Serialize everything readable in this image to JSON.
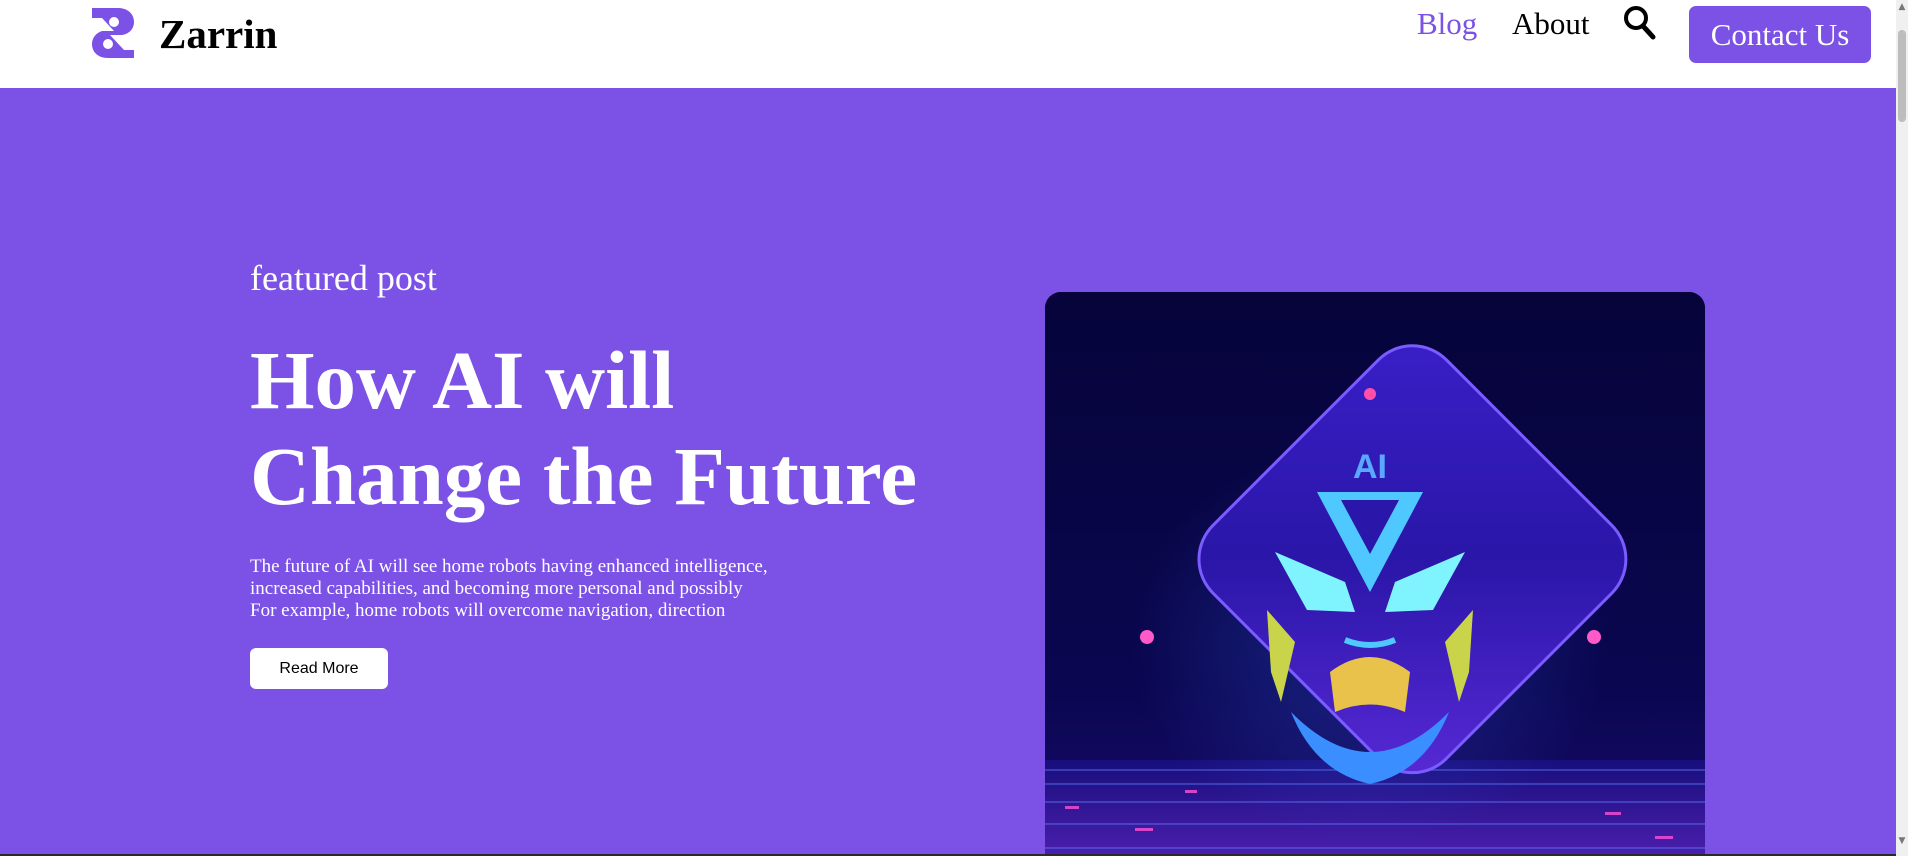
{
  "header": {
    "brand": "Zarrin",
    "nav": {
      "blog": "Blog",
      "about": "About"
    },
    "contact_label": "Contact Us",
    "icons": {
      "logo": "zarrin-logo",
      "search": "search-icon"
    }
  },
  "hero": {
    "eyebrow": "featured post",
    "title_line1": "How AI will",
    "title_line2": "Change the Future",
    "excerpt_line1": "The future of AI will see home robots having enhanced intelligence,",
    "excerpt_line2": "increased capabilities, and becoming more personal and possibly",
    "excerpt_line3": "For example, home robots will overcome navigation, direction",
    "read_more": "Read More",
    "image": {
      "badge_text": "AI"
    }
  },
  "colors": {
    "accent": "#7b51e6",
    "hero_bg": "#7b51e6",
    "image_bg": "#07053a",
    "text_light": "#ffffff",
    "text_dark": "#000000"
  }
}
